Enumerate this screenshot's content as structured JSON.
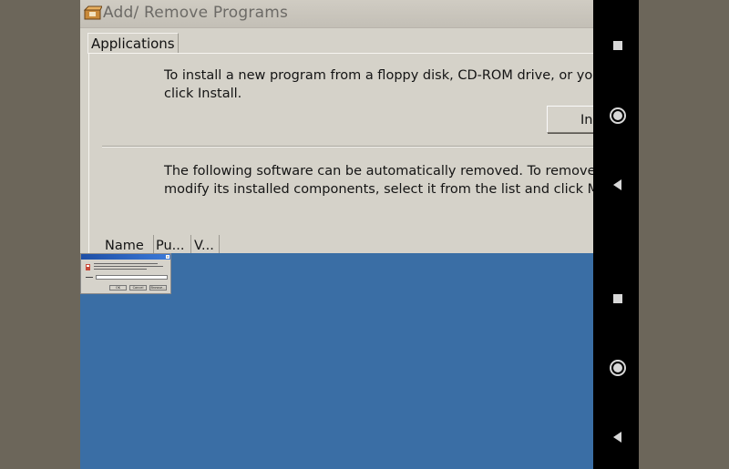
{
  "window": {
    "title": "Add/ Remove Programs",
    "tab_label": "Applications",
    "install_text_line1": "To install a new program from a floppy disk, CD-ROM drive, or your har",
    "install_text_line2": "click Install.",
    "install_button_label": "In",
    "remove_text_line1": "The following software can be automatically removed. To remove a pro",
    "remove_text_line2": "modify its installed components, select it from the list and click Modify/",
    "columns": [
      "Name",
      "Pu...",
      "V..."
    ]
  },
  "run_dialog": {
    "buttons": [
      "OK",
      "Cancel",
      "Browse..."
    ]
  },
  "nav": {
    "icons": [
      "square-icon",
      "circle-icon",
      "back-triangle-icon",
      "square-icon",
      "circle-icon",
      "back-triangle-icon"
    ]
  },
  "colors": {
    "desktop": "#3a6ea5",
    "window_bg": "#d5d2c9",
    "outer_bg": "#6c665a",
    "navbar": "#000000"
  }
}
